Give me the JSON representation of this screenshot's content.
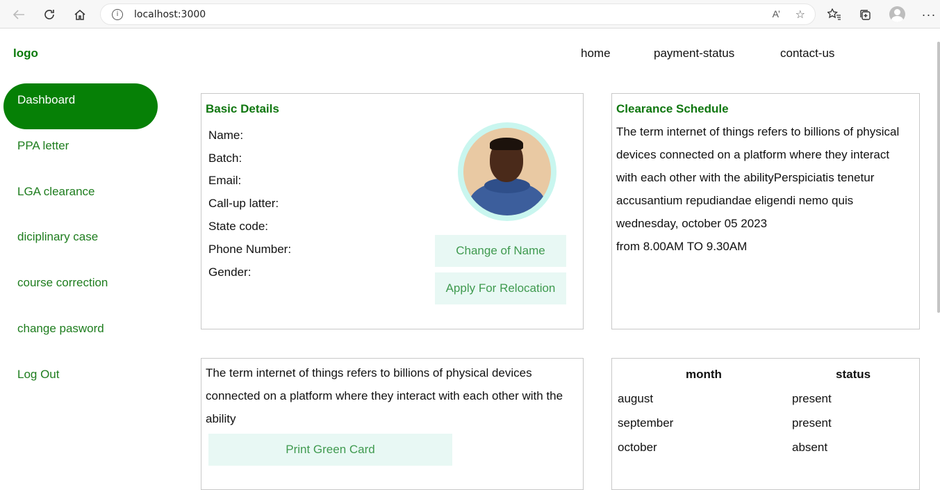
{
  "browser": {
    "url": "localhost:3000",
    "read_aloud_label": "A’",
    "icons": [
      "back-arrow-icon",
      "refresh-icon",
      "home-icon",
      "info-icon",
      "read-aloud-icon",
      "favorite-add-icon",
      "favorites-icon",
      "collections-icon",
      "profile-icon",
      "more-icon"
    ]
  },
  "header": {
    "logo": "logo",
    "nav": [
      "home",
      "payment-status",
      "contact-us"
    ]
  },
  "sidebar": {
    "items": [
      {
        "label": "Dashboard"
      },
      {
        "label": "PPA letter"
      },
      {
        "label": "LGA clearance"
      },
      {
        "label": "diciplinary case"
      },
      {
        "label": "course correction"
      },
      {
        "label": "change pasword"
      },
      {
        "label": "Log Out"
      }
    ]
  },
  "basic_details": {
    "title": "Basic Details",
    "fields": [
      "Name:",
      "Batch:",
      "Email:",
      "Call-up latter:",
      "State code:",
      "Phone Number:",
      "Gender:"
    ],
    "change_name_button": "Change of Name",
    "relocation_button": "Apply For Relocation"
  },
  "clearance": {
    "title": "Clearance Schedule",
    "lines": [
      "The term internet of things refers to billions of physical",
      "devices connected on a platform where they interact",
      "with each other with the abilityPerspiciatis tenetur",
      "accusantium repudiandae eligendi nemo quis",
      "wednesday, october 05 2023",
      "from 8.00AM TO 9.30AM"
    ]
  },
  "green_card": {
    "lines": [
      "The term internet of things refers to billions of physical devices",
      "connected on a platform where they interact with each other with the",
      "ability"
    ],
    "print_button": "Print Green Card"
  },
  "attendance": {
    "headers": [
      "month",
      "status"
    ],
    "rows": [
      [
        "august",
        "present"
      ],
      [
        "september",
        "present"
      ],
      [
        "october",
        "absent"
      ]
    ]
  },
  "colors": {
    "brand_green": "#068006",
    "mint_button": "#e8f8f4"
  }
}
